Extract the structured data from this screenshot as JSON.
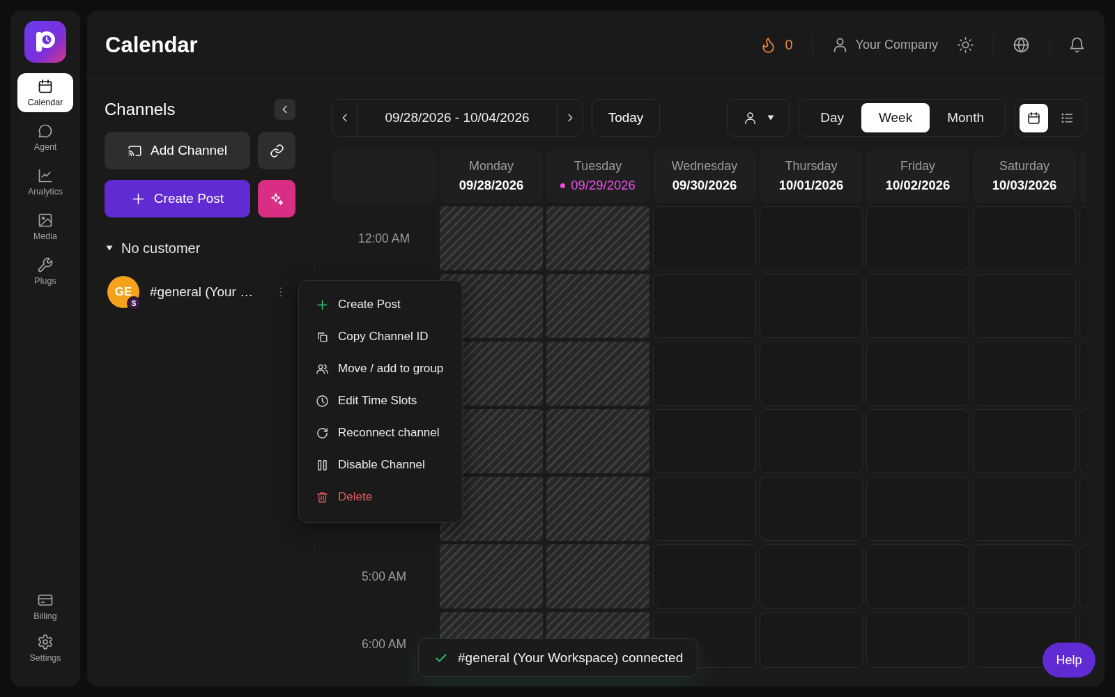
{
  "nav": {
    "items": [
      {
        "label": "Calendar",
        "selected": true
      },
      {
        "label": "Agent",
        "selected": false
      },
      {
        "label": "Analytics",
        "selected": false
      },
      {
        "label": "Media",
        "selected": false
      },
      {
        "label": "Plugs",
        "selected": false
      }
    ],
    "bottom_items": [
      {
        "label": "Billing",
        "selected": false
      },
      {
        "label": "Settings",
        "selected": false
      }
    ]
  },
  "header": {
    "title": "Calendar",
    "streak": "0",
    "company": "Your Company"
  },
  "channels": {
    "title": "Channels",
    "add_button": "Add Channel",
    "create_button": "Create Post",
    "group": {
      "label": "No customer",
      "expanded": true
    },
    "items": [
      {
        "initials": "GE",
        "badge": "S",
        "name": "#general (Your …"
      }
    ]
  },
  "toolbar": {
    "date_range": "09/28/2026 - 10/04/2026",
    "today_button": "Today",
    "views": [
      {
        "label": "Day",
        "selected": false
      },
      {
        "label": "Week",
        "selected": true
      },
      {
        "label": "Month",
        "selected": false
      }
    ],
    "layouts": [
      {
        "selected": true
      },
      {
        "selected": false
      }
    ]
  },
  "calendar": {
    "days": [
      {
        "name": "Monday",
        "date": "09/28/2026",
        "today": false
      },
      {
        "name": "Tuesday",
        "date": "09/29/2026",
        "today": true
      },
      {
        "name": "Wednesday",
        "date": "09/30/2026",
        "today": false
      },
      {
        "name": "Thursday",
        "date": "10/01/2026",
        "today": false
      },
      {
        "name": "Friday",
        "date": "10/02/2026",
        "today": false
      },
      {
        "name": "Saturday",
        "date": "10/03/2026",
        "today": false
      }
    ],
    "rows": [
      {
        "time": "12:00 AM",
        "cells": [
          {
            "past": true
          },
          {
            "past": true
          },
          {
            "past": false
          },
          {
            "past": false
          },
          {
            "past": false
          },
          {
            "past": false
          }
        ]
      },
      {
        "cells": [
          {
            "past": true
          },
          {
            "past": true
          },
          {
            "past": false
          },
          {
            "past": false
          },
          {
            "past": false
          },
          {
            "past": false
          }
        ]
      },
      {
        "cells": [
          {
            "past": true
          },
          {
            "past": true
          },
          {
            "past": false
          },
          {
            "past": false
          },
          {
            "past": false
          },
          {
            "past": false
          }
        ]
      },
      {
        "cells": [
          {
            "past": true
          },
          {
            "past": true
          },
          {
            "past": false
          },
          {
            "past": false
          },
          {
            "past": false
          },
          {
            "past": false
          }
        ]
      },
      {
        "cells": [
          {
            "past": true
          },
          {
            "past": true
          },
          {
            "past": false
          },
          {
            "past": false
          },
          {
            "past": false
          },
          {
            "past": false
          }
        ]
      },
      {
        "time": "5:00 AM",
        "cells": [
          {
            "past": true
          },
          {
            "past": true
          },
          {
            "past": false
          },
          {
            "past": false
          },
          {
            "past": false
          },
          {
            "past": false
          }
        ]
      },
      {
        "time": "6:00 AM",
        "cells": [
          {
            "past": true
          },
          {
            "past": true
          },
          {
            "past": false
          },
          {
            "past": false
          },
          {
            "past": false
          },
          {
            "past": false
          }
        ]
      }
    ]
  },
  "context_menu": {
    "items": [
      {
        "label": "Create Post",
        "kind": "add"
      },
      {
        "label": "Copy Channel ID",
        "kind": "normal"
      },
      {
        "label": "Move / add to group",
        "kind": "normal"
      },
      {
        "label": "Edit Time Slots",
        "kind": "normal"
      },
      {
        "label": "Reconnect channel",
        "kind": "normal"
      },
      {
        "label": "Disable Channel",
        "kind": "normal"
      },
      {
        "label": "Delete",
        "kind": "danger"
      }
    ]
  },
  "toast": {
    "message": "#general (Your Workspace) connected",
    "kind": "success"
  },
  "help_button": "Help"
}
